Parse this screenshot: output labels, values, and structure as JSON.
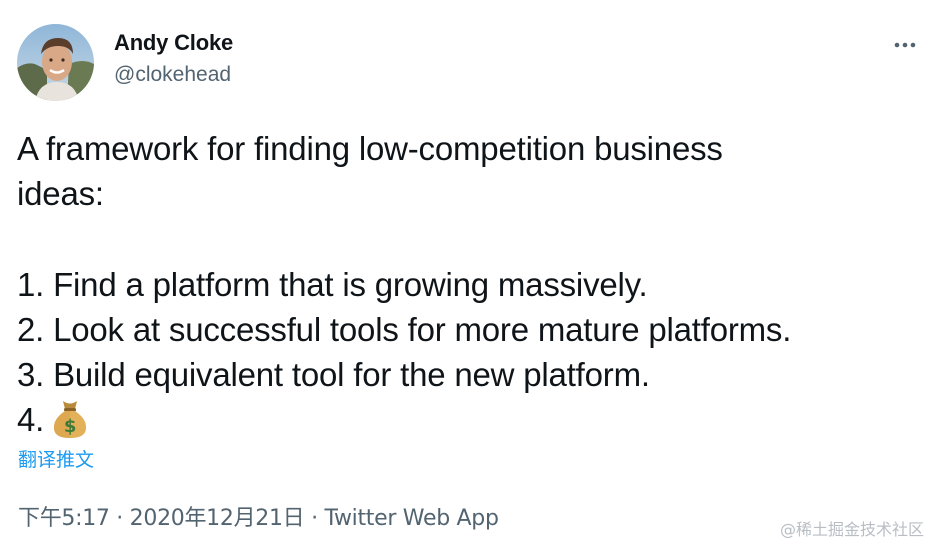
{
  "tweet": {
    "author": {
      "name": "Andy Cloke",
      "handle": "@clokehead"
    },
    "text_lines": [
      "A framework for finding low-competition business",
      "ideas:",
      "",
      "1. Find a platform that is growing massively.",
      "2. Look at successful tools for more mature platforms.",
      "3. Build equivalent tool for the new platform.",
      "4."
    ],
    "final_line_icon": "money-bag-icon",
    "translate_label": "翻译推文",
    "timestamp": "下午5:17 · 2020年12月21日",
    "separator": " · ",
    "source": "Twitter Web App"
  },
  "watermark": "@稀土掘金技术社区",
  "colors": {
    "text": "#0f1419",
    "secondary": "#536471",
    "link": "#1d9bf0",
    "watermark": "#b8bec4"
  }
}
